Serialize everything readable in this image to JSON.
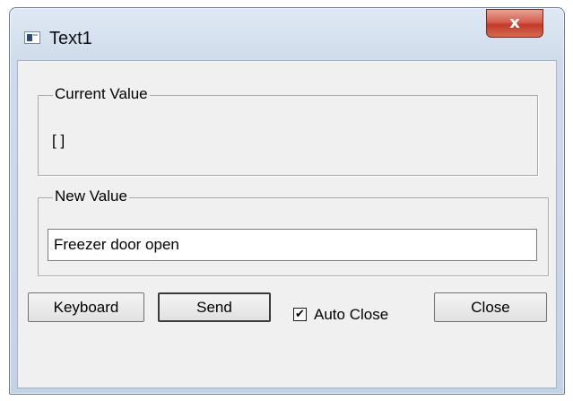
{
  "window": {
    "title": "Text1",
    "close_glyph": "x",
    "app_icon": "app-window-icon"
  },
  "current_value": {
    "label": "Current Value",
    "value": "[ ]"
  },
  "new_value": {
    "label": "New Value",
    "value": "Freezer door open"
  },
  "buttons": {
    "keyboard": "Keyboard",
    "send": "Send",
    "close": "Close"
  },
  "auto_close": {
    "label": "Auto Close",
    "checked": true,
    "check_glyph": "✔"
  }
}
